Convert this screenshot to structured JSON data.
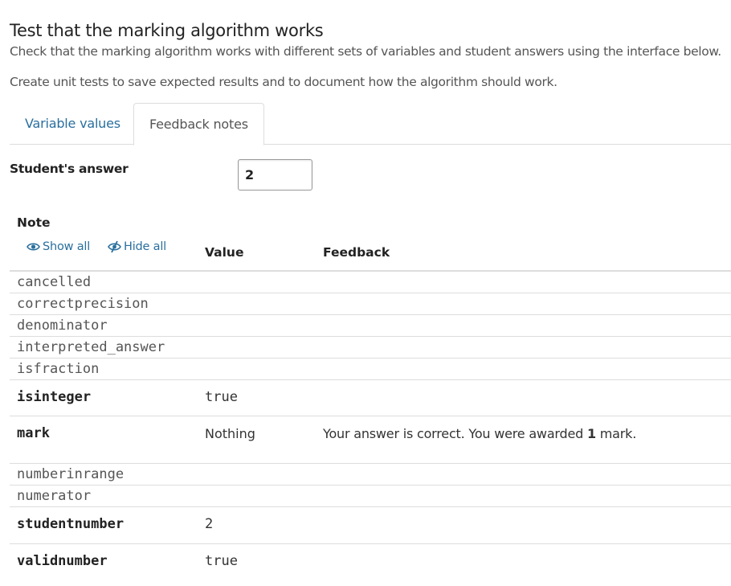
{
  "page": {
    "title": "Test that the marking algorithm works",
    "description_1": "Check that the marking algorithm works with different sets of variables and student answers using the interface below.",
    "description_2": "Create unit tests to save expected results and to document how the algorithm should work."
  },
  "tabs": [
    {
      "label": "Variable values",
      "active": false
    },
    {
      "label": "Feedback notes",
      "active": true
    }
  ],
  "answer": {
    "label": "Student's answer",
    "value": "2"
  },
  "table": {
    "header_note": "Note",
    "header_value": "Value",
    "header_feedback": "Feedback",
    "show_all": "Show all",
    "hide_all": "Hide all",
    "rows": [
      {
        "name": "cancelled",
        "value": "",
        "feedback": ""
      },
      {
        "name": "correctprecision",
        "value": "",
        "feedback": ""
      },
      {
        "name": "denominator",
        "value": "",
        "feedback": ""
      },
      {
        "name": "interpreted_answer",
        "value": "",
        "feedback": ""
      },
      {
        "name": "isfraction",
        "value": "",
        "feedback": ""
      },
      {
        "name": "isinteger",
        "value": "true",
        "feedback": ""
      },
      {
        "name": "mark",
        "value": "Nothing",
        "feedback_pre": "Your answer is correct. You were awarded ",
        "feedback_mark": "1",
        "feedback_post": " mark."
      },
      {
        "name": "numberinrange",
        "value": "",
        "feedback": ""
      },
      {
        "name": "numerator",
        "value": "",
        "feedback": ""
      },
      {
        "name": "studentnumber",
        "value": "2",
        "feedback": ""
      },
      {
        "name": "validnumber",
        "value": "true",
        "feedback": ""
      }
    ]
  },
  "colors": {
    "link": "#2a6f9e",
    "border": "#dddddd",
    "text": "#333333"
  }
}
